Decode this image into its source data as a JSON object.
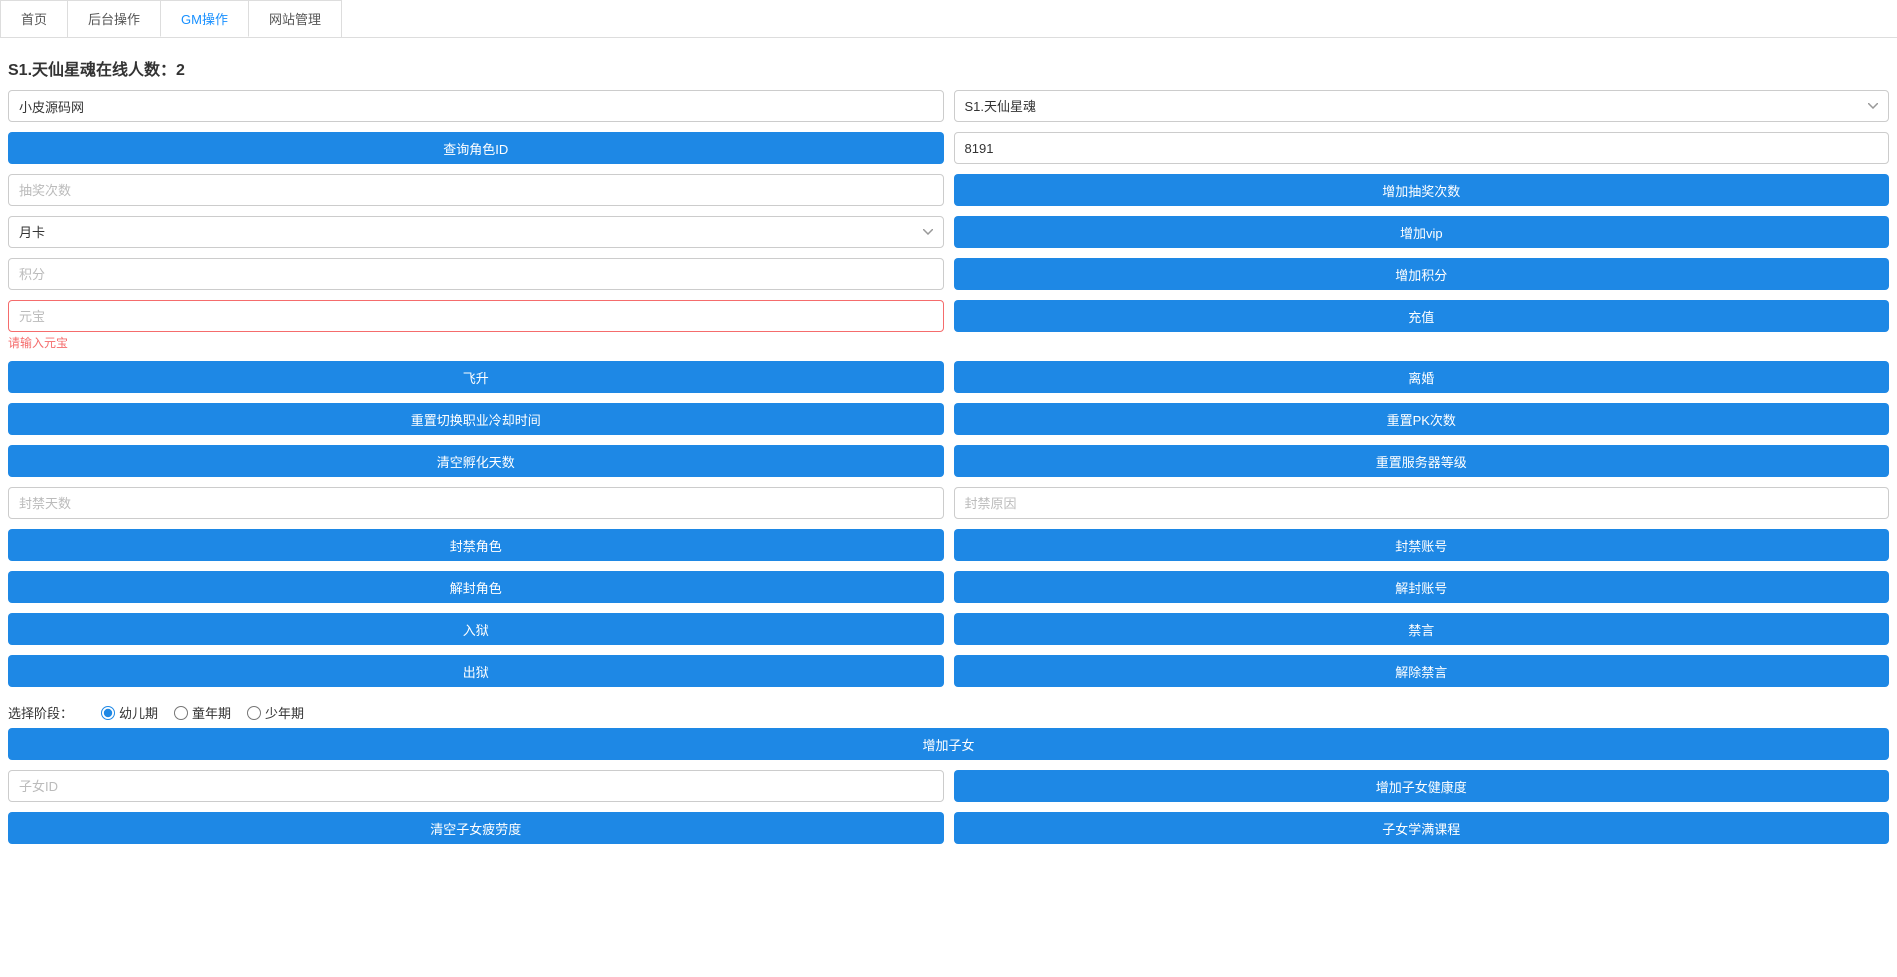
{
  "tabs": {
    "home": "首页",
    "backend": "后台操作",
    "gm": "GM操作",
    "site": "网站管理"
  },
  "heading": "S1.天仙星魂在线人数：2",
  "inputs": {
    "account_value": "小皮源码网",
    "server_option": "S1.天仙星魂",
    "role_id_value": "8191",
    "lottery_placeholder": "抽奖次数",
    "vip_option": "月卡",
    "points_placeholder": "积分",
    "yuanbao_placeholder": "元宝",
    "yuanbao_error": "请输入元宝",
    "ban_days_placeholder": "封禁天数",
    "ban_reason_placeholder": "封禁原因",
    "child_id_placeholder": "子女ID"
  },
  "buttons": {
    "query_role_id": "查询角色ID",
    "add_lottery": "增加抽奖次数",
    "add_vip": "增加vip",
    "add_points": "增加积分",
    "recharge": "充值",
    "ascend": "飞升",
    "divorce": "离婚",
    "reset_job_cd": "重置切换职业冷却时间",
    "reset_pk": "重置PK次数",
    "clear_hatch": "清空孵化天数",
    "reset_server_level": "重置服务器等级",
    "ban_role": "封禁角色",
    "ban_account": "封禁账号",
    "unban_role": "解封角色",
    "unban_account": "解封账号",
    "jail": "入狱",
    "mute": "禁言",
    "unjail": "出狱",
    "unmute": "解除禁言",
    "add_child": "增加子女",
    "add_child_health": "增加子女健康度",
    "clear_child_fatigue": "清空子女疲劳度",
    "child_full_course": "子女学满课程"
  },
  "radio": {
    "label": "选择阶段：",
    "opt1": "幼儿期",
    "opt2": "童年期",
    "opt3": "少年期"
  }
}
